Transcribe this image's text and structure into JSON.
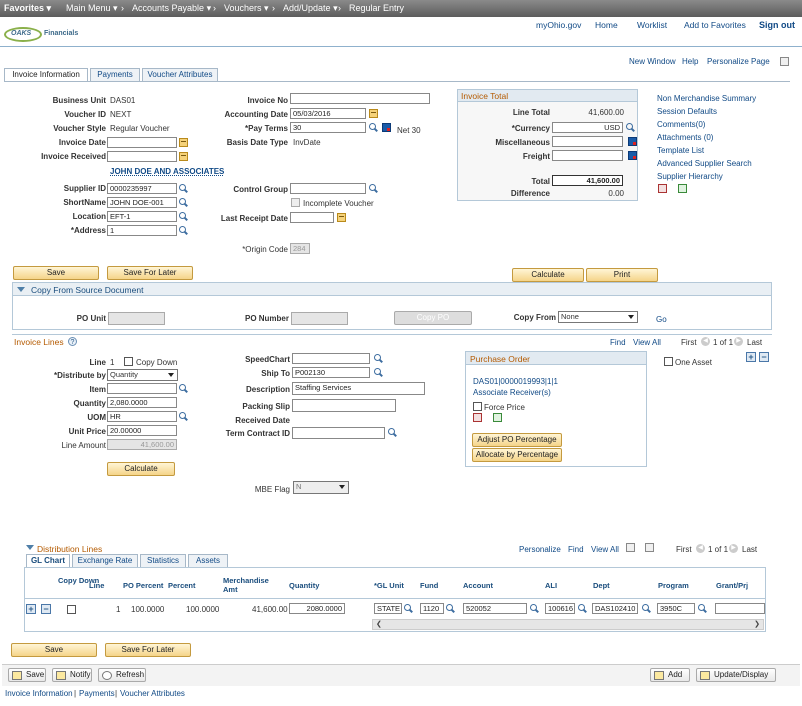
{
  "topnav": {
    "favorites": "Favorites",
    "main_menu": "Main Menu",
    "accounts_payable": "Accounts Payable",
    "vouchers": "Vouchers",
    "add_update": "Add/Update",
    "regular_entry": "Regular Entry",
    "sep": "›",
    "dropdown": "▾"
  },
  "header_links": {
    "myohio": "myOhio.gov",
    "home": "Home",
    "worklist": "Worklist",
    "add_favorites": "Add to Favorites",
    "sign_out": "Sign out"
  },
  "logo": {
    "oaks": "OAKS",
    "financials": "Financials"
  },
  "page_links": {
    "new_window": "New Window",
    "help": "Help",
    "personalize": "Personalize Page"
  },
  "tabs": [
    "Invoice Information",
    "Payments",
    "Voucher Attributes"
  ],
  "header": {
    "business_unit_label": "Business Unit",
    "business_unit": "DAS01",
    "voucher_id_label": "Voucher ID",
    "voucher_id": "NEXT",
    "voucher_style_label": "Voucher Style",
    "voucher_style": "Regular Voucher",
    "invoice_date_label": "Invoice Date",
    "invoice_date": "",
    "invoice_received_label": "Invoice Received",
    "invoice_received": "",
    "supplier_name": "JOHN DOE AND ASSOCIATES",
    "supplier_id_label": "Supplier ID",
    "supplier_id": "0000235997",
    "shortname_label": "ShortName",
    "shortname": "JOHN DOE-001",
    "location_label": "Location",
    "location": "EFT-1",
    "address_label": "*Address",
    "address": "1",
    "invoice_no_label": "Invoice No",
    "invoice_no": "",
    "accounting_date_label": "Accounting Date",
    "accounting_date": "05/03/2016",
    "pay_terms_label": "*Pay Terms",
    "pay_terms": "30",
    "pay_terms_desc": "Net 30",
    "basis_date_type_label": "Basis Date Type",
    "basis_date_type": "InvDate",
    "control_group_label": "Control Group",
    "control_group": "",
    "incomplete_voucher_label": "Incomplete Voucher",
    "last_receipt_date_label": "Last Receipt Date",
    "last_receipt_date": "",
    "origin_code_label": "*Origin Code",
    "origin_code": "284"
  },
  "invoice_total": {
    "title": "Invoice Total",
    "line_total_label": "Line Total",
    "line_total": "41,600.00",
    "currency_label": "*Currency",
    "currency": "USD",
    "misc_label": "Miscellaneous",
    "misc": "",
    "freight_label": "Freight",
    "freight": "",
    "total_label": "Total",
    "total": "41,600.00",
    "difference_label": "Difference",
    "difference": "0.00"
  },
  "side_links": [
    "Non Merchandise Summary",
    "Session Defaults",
    "Comments(0)",
    "Attachments (0)",
    "Template List",
    "Advanced Supplier Search",
    "Supplier Hierarchy"
  ],
  "buttons": {
    "save": "Save",
    "save_later": "Save For Later",
    "calculate": "Calculate",
    "print": "Print",
    "copy_po": "Copy PO",
    "go": "Go",
    "line_calculate": "Calculate",
    "adjust_po": "Adjust PO Percentage",
    "allocate": "Allocate by Percentage",
    "notify": "Notify",
    "refresh": "Refresh",
    "add": "Add",
    "update_display": "Update/Display"
  },
  "copy_from": {
    "title": "Copy From Source Document",
    "po_unit_label": "PO Unit",
    "po_unit": "",
    "po_number_label": "PO Number",
    "po_number": "",
    "copy_from_label": "Copy From",
    "copy_from": "None"
  },
  "invoice_lines": {
    "title": "Invoice Lines",
    "help": "?",
    "find": "Find",
    "view_all": "View All",
    "first": "First",
    "page": "1 of 1",
    "last": "Last",
    "line_label": "Line",
    "line": "1",
    "copy_down_label": "Copy Down",
    "distribute_by_label": "*Distribute by",
    "distribute_by": "Quantity",
    "item_label": "Item",
    "item": "",
    "quantity_label": "Quantity",
    "quantity": "2,080.0000",
    "uom_label": "UOM",
    "uom": "HR",
    "unit_price_label": "Unit Price",
    "unit_price": "20.00000",
    "line_amount_label": "Line Amount",
    "line_amount": "41,600.00",
    "speedchart_label": "SpeedChart",
    "speedchart": "",
    "ship_to_label": "Ship To",
    "ship_to": "P002130",
    "description_label": "Description",
    "description": "Staffing Services",
    "packing_slip_label": "Packing Slip",
    "packing_slip": "",
    "received_date_label": "Received Date",
    "term_contract_label": "Term Contract ID",
    "term_contract": "",
    "mbe_flag_label": "MBE Flag",
    "mbe_flag": "N",
    "one_asset_label": "One Asset",
    "po_title": "Purchase Order",
    "po_ref": "DAS01|0000019993|1|1",
    "associate_receiver": "Associate Receiver(s)",
    "force_price_label": "Force Price"
  },
  "distribution": {
    "title": "Distribution Lines",
    "personalize": "Personalize",
    "find": "Find",
    "view_all": "View All",
    "first": "First",
    "page": "1 of 1",
    "last": "Last",
    "tabs": [
      "GL Chart",
      "Exchange Rate",
      "Statistics",
      "Assets"
    ],
    "headers": {
      "copy_down": "Copy Down",
      "line": "Line",
      "po_percent": "PO Percent",
      "percent": "Percent",
      "merch_amt": "Merchandise Amt",
      "quantity": "Quantity",
      "gl_unit": "*GL Unit",
      "fund": "Fund",
      "account": "Account",
      "ali": "ALI",
      "dept": "Dept",
      "program": "Program",
      "grant": "Grant/Prj"
    },
    "row": {
      "line": "1",
      "po_percent": "100.0000",
      "percent": "100.0000",
      "merch_amt": "41,600.00",
      "quantity": "2080.0000",
      "gl_unit": "STATE",
      "fund": "1120",
      "account": "520052",
      "ali": "100616",
      "dept": "DAS102410",
      "program": "3950C",
      "grant": ""
    }
  },
  "footer_links": [
    "Invoice Information",
    "Payments",
    "Voucher Attributes"
  ],
  "colors": {
    "link": "#114a86",
    "section_title": "#b45a00",
    "button": "#f5d489"
  }
}
